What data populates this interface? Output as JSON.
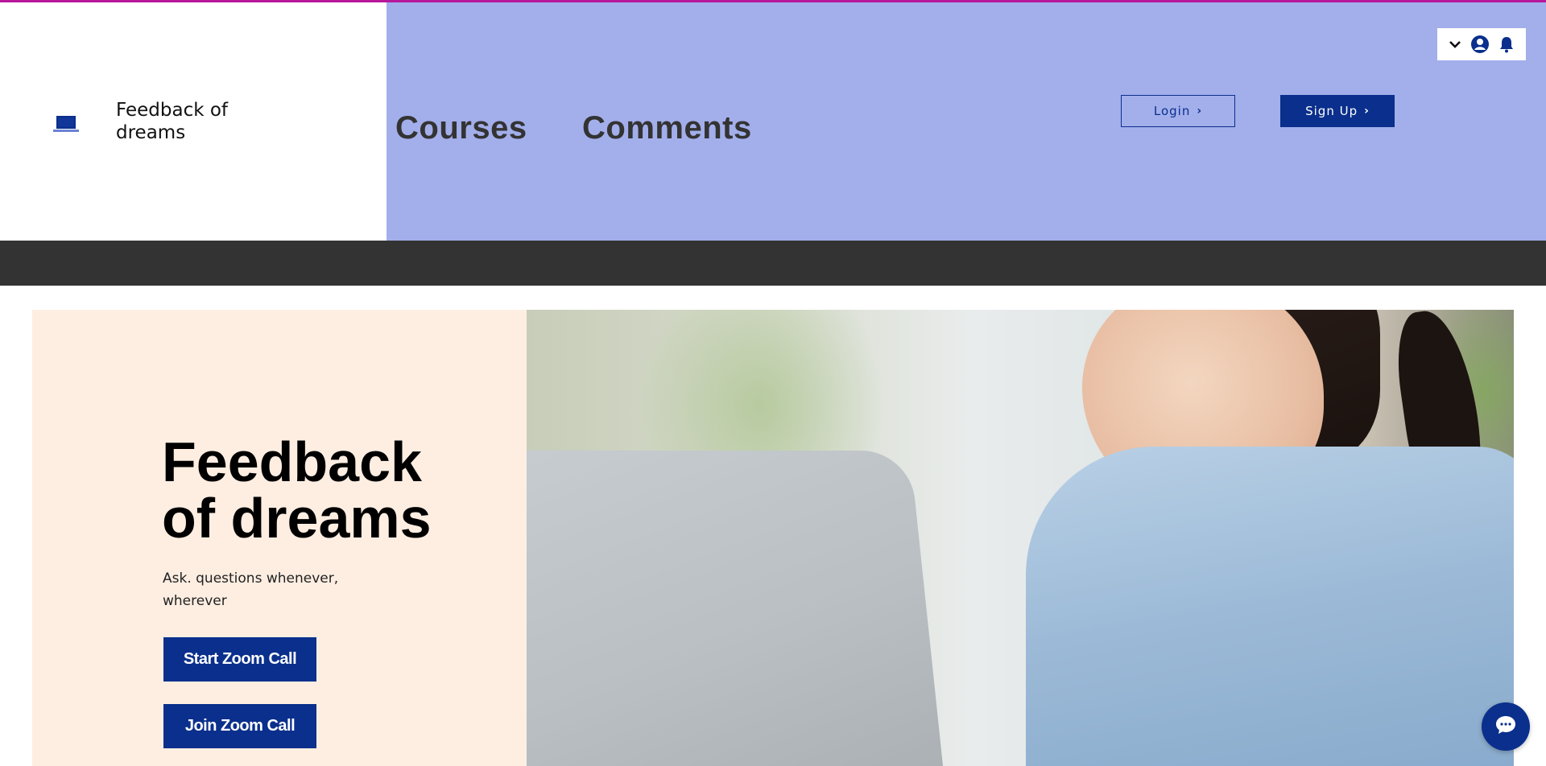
{
  "site": {
    "name": "Feedback of dreams",
    "logo_icon": "laptop-icon"
  },
  "nav": {
    "links": [
      {
        "label": "Courses"
      },
      {
        "label": "Comments"
      }
    ]
  },
  "auth": {
    "login_label": "Login",
    "signup_label": "Sign Up",
    "chevron": "›"
  },
  "member_bar": {
    "icons": [
      "chevron-down-icon",
      "user-avatar-icon",
      "bell-icon"
    ]
  },
  "hero": {
    "title": "Feedback of dreams",
    "subtitle": "Ask. questions whenever, wherever",
    "start_button": "Start Zoom Call",
    "join_button": "Join Zoom Call"
  },
  "chat": {
    "icon": "chat-icon"
  },
  "colors": {
    "accent_line": "#b6179b",
    "nav_bg": "#a3afeb",
    "brand_blue": "#0a2f8c",
    "dark_strip": "#333333",
    "hero_bg": "#feeee2"
  }
}
